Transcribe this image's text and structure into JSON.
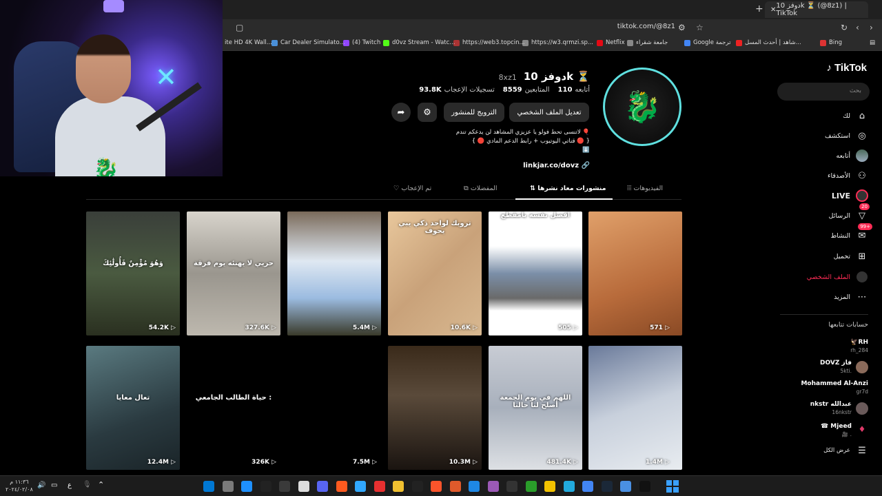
{
  "browser": {
    "tab_title": "دوفز 10k ⏳ (@8z1) | TikTok",
    "url": "tiktok.com/@8z1",
    "bookmarks": [
      {
        "label": "Bing",
        "color": "#d33"
      },
      {
        "label": "شاهد | أحدث المسل...",
        "color": "#e22"
      },
      {
        "label": "Google ترجمة",
        "color": "#4285f4"
      },
      {
        "label": "جامعة شقراء",
        "color": "#888"
      },
      {
        "label": "Netflix",
        "color": "#e50914"
      },
      {
        "label": "https://w3.qrmzi.sp...",
        "color": "#888"
      },
      {
        "label": "https://web3.topcin...",
        "color": "#a33"
      },
      {
        "label": "d0vz Stream - Watc...",
        "color": "#53fc18"
      },
      {
        "label": "(4) Twitch",
        "color": "#9146ff"
      },
      {
        "label": "Car Dealer Simulato...",
        "color": "#4a90d9"
      },
      {
        "label": "ite HD 4K Wall...",
        "color": "#666"
      }
    ]
  },
  "sidebar": {
    "logo": "TikTok",
    "search_placeholder": "بحث",
    "items": [
      {
        "label": "لك",
        "icon": "home-icon"
      },
      {
        "label": "استكشف",
        "icon": "compass-icon"
      },
      {
        "label": "أتابعه",
        "icon": "avatar-icon"
      },
      {
        "label": "الأصدقاء",
        "icon": "friends-icon"
      },
      {
        "label": "LIVE",
        "icon": "live-icon"
      },
      {
        "label": "الرسائل",
        "icon": "messages-icon",
        "badge": "20"
      },
      {
        "label": "النشاط",
        "icon": "activity-icon",
        "badge": "99+"
      },
      {
        "label": "تحميل",
        "icon": "upload-icon"
      },
      {
        "label": "الملف الشخصي",
        "icon": "profile-icon"
      },
      {
        "label": "المزيد",
        "icon": "more-icon"
      }
    ],
    "following_title": "حسابات تتابعها",
    "accounts": [
      {
        "name": "🦅RH",
        "handle": "rh_284"
      },
      {
        "name": "DOVZ فاز",
        "handle": "5kti."
      },
      {
        "name": "Mohammed Al-Anzi",
        "handle": "gr7d"
      },
      {
        "name": "nkstr عبدالله",
        "handle": "16nkstr"
      },
      {
        "name": "☎ Mjeed",
        "handle": "🎥 ."
      }
    ],
    "show_all": "عرض الكل"
  },
  "profile": {
    "name": "دوفز 10k ⏳",
    "handle": "8xz1",
    "following_count": "110",
    "following_label": "أتابعه",
    "followers_count": "8559",
    "followers_label": "المتابعين",
    "likes_count": "93.8K",
    "likes_label": "تسجيلات الإعجاب",
    "edit_button": "تعديل الملف الشخصي",
    "promote_button": "الترويج للمنشور",
    "bio_line1": "لاتنسى تحط فولو يا عزيزي المشاهد لن يدعكم تندم 🎈",
    "bio_line2": "{ 🔴 قناتي اليوتيوب + رابط الدعم المادي 🔴 }",
    "bio_line3": "⬇️",
    "link": "linkjar.co/dovz"
  },
  "tabs": {
    "videos": "الفيديوهات",
    "reposts": "منشورات معاد نشرها",
    "favorites": "المفضلات",
    "liked": "تم الإعجاب"
  },
  "videos": [
    {
      "views": "571",
      "caption": "",
      "bg": "linear-gradient(160deg,#e0a06a,#b86b3b 60%,#8a4a25)"
    },
    {
      "views": "505",
      "caption": "افصل نفسه بامقطع",
      "bg": "linear-gradient(#fff 0,#fff 28%,#7b8fa8 50%,#6a6a6a 70%,#fff 80%)"
    },
    {
      "views": "10.6K",
      "caption": "تروبك لواحد ذكي يبي يحوف",
      "bg": "linear-gradient(135deg,#e8c79c,#c9a27a 50%,#d8b890)"
    },
    {
      "views": "5.4M",
      "caption": "",
      "bg": "linear-gradient(180deg,#7a6a5a,#dfe8f2 40%,#9bbbe0 70%,#3a3a2a)"
    },
    {
      "views": "327.6K",
      "caption": "حريي لا يهنئه يوم فرقة",
      "bg": "linear-gradient(180deg,#d8d4cc,#9a968e 50%,#bdb8ae)"
    },
    {
      "views": "54.2K",
      "caption": "وَهُوَ مُؤْمِنٌ فَأُولَٰئِكَ",
      "bg": "linear-gradient(180deg,#3a3f3a,#4a5a40 50%,#2a3020)"
    },
    {
      "views": "1.4M",
      "caption": "",
      "bg": "linear-gradient(160deg,#6a7a9a,#c8d0dc 50%,#e8ecf0)"
    },
    {
      "views": "481.4K",
      "caption": "اللهم في يوم الجمعة أصلح لنا حالنا",
      "bg": "linear-gradient(180deg,#c8ccd4,#a8b0bc 50%,#dde0e4)"
    },
    {
      "views": "10.3M",
      "caption": "",
      "bg": "linear-gradient(180deg,#3a2a1a,#5a4a3a 40%,#1a1410)"
    },
    {
      "views": "7.5M",
      "caption": "",
      "bg": "#000"
    },
    {
      "views": "326K",
      "caption": "حياة الطالب الجامعي :",
      "bg": "#000"
    },
    {
      "views": "12.4M",
      "caption": "تعال معايا",
      "bg": "linear-gradient(160deg,#5a7a80,#2a3a40 60%,#1a2428)"
    }
  ],
  "taskbar": {
    "time": "١١:٣٦ م",
    "date": "٢٠٢٤/٠٢/٠٨",
    "lang": "ع"
  },
  "webcam": {
    "neon": "✕"
  }
}
